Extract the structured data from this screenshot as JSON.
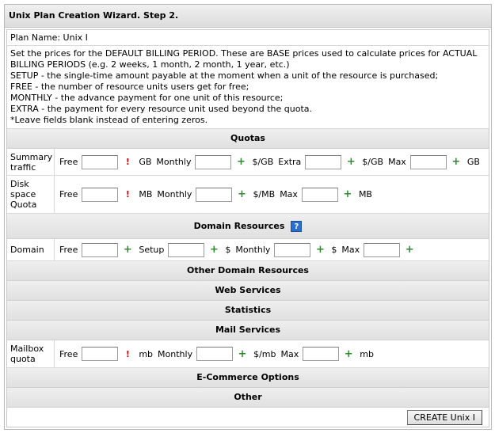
{
  "title": "Unix Plan Creation Wizard. Step 2.",
  "plan_name": "Plan Name: Unix I",
  "description": [
    "Set the prices for the DEFAULT BILLING PERIOD. These are BASE prices used to calculate prices for ACTUAL",
    "BILLING PERIODS (e.g. 2 weeks, 1 month, 2 month, 1 year, etc.)",
    "SETUP - the single-time amount payable at the moment when a unit of the resource is purchased;",
    "FREE - the number of resource units users get for free;",
    "MONTHLY - the advance payment for one unit of this resource;",
    "EXTRA - the payment for every resource unit used beyond the quota.",
    "*Leave fields blank instead of entering zeros."
  ],
  "sections": {
    "quotas": "Quotas",
    "domain_resources": "Domain Resources",
    "other_domain_resources": "Other Domain Resources",
    "web_services": "Web Services",
    "statistics": "Statistics",
    "mail_services": "Mail Services",
    "ecommerce": "E-Commerce Options",
    "other": "Other"
  },
  "summary_traffic": {
    "label_line1": "Summary",
    "label_line2": "traffic",
    "free": "Free",
    "free_unit": "GB",
    "monthly": "Monthly",
    "monthly_unit": "$/GB",
    "extra": "Extra",
    "extra_unit": "$/GB",
    "max": "Max",
    "max_unit": "GB"
  },
  "disk_space": {
    "label_line1": "Disk",
    "label_line2": "space",
    "label_line3": "Quota",
    "free": "Free",
    "free_unit": "MB",
    "monthly": "Monthly",
    "monthly_unit": "$/MB",
    "max": "Max",
    "max_unit": "MB"
  },
  "domain": {
    "label": "Domain",
    "free": "Free",
    "setup": "Setup",
    "setup_unit": "$",
    "monthly": "Monthly",
    "monthly_unit": "$",
    "max": "Max"
  },
  "mailbox": {
    "label_line1": "Mailbox",
    "label_line2": "quota",
    "free": "Free",
    "free_unit": "mb",
    "monthly": "Monthly",
    "monthly_unit": "$/mb",
    "max": "Max",
    "max_unit": "mb"
  },
  "icons": {
    "required": "!",
    "add": "+",
    "help": "?"
  },
  "colors": {
    "required": "#e00000",
    "add": "#2e8b2e",
    "help": "#2a6fd0"
  },
  "create_button": "CREATE Unix I"
}
